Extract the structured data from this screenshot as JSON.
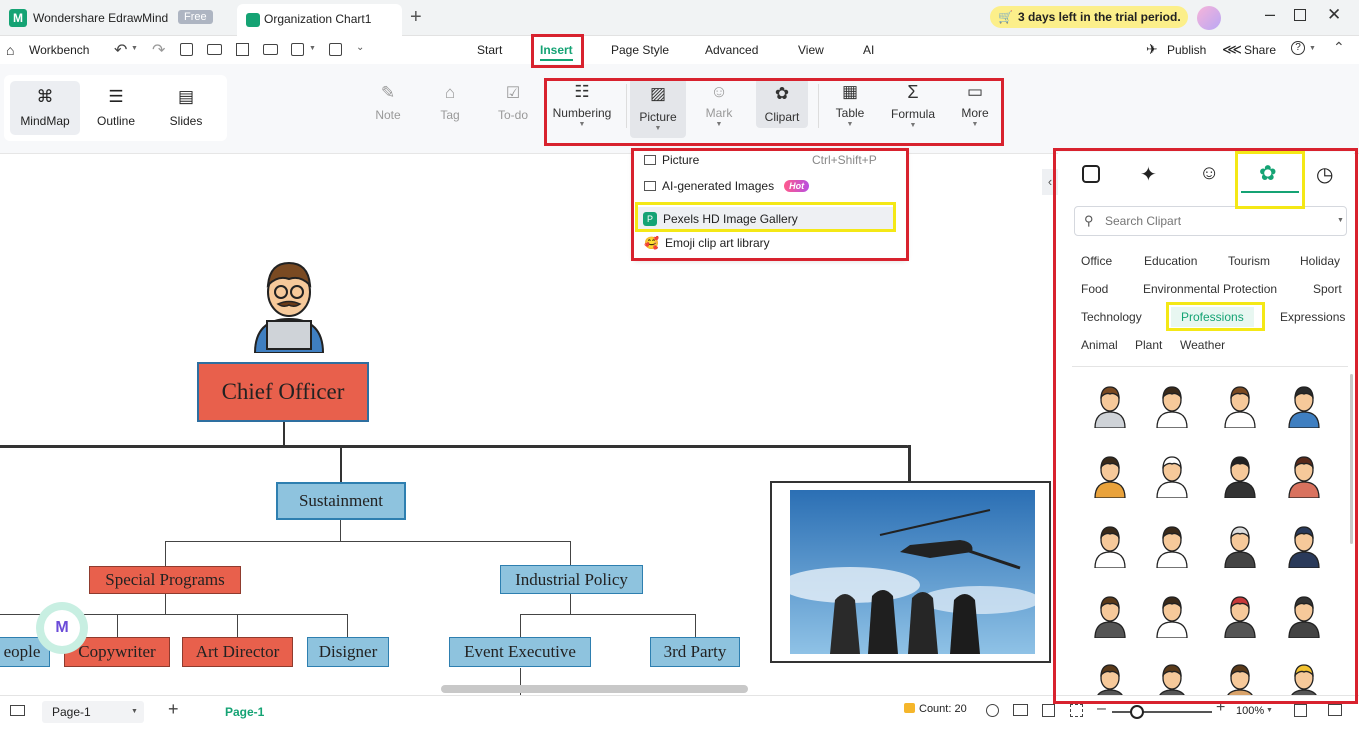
{
  "app": {
    "name": "Wondershare EdrawMind",
    "badge": "Free",
    "doc_tab": "Organization Chart1",
    "trial": "3 days left in the trial period."
  },
  "menu": {
    "workbench": "Workbench",
    "tabs": [
      "Start",
      "Insert",
      "Page Style",
      "Advanced",
      "View",
      "AI"
    ],
    "publish": "Publish",
    "share": "Share"
  },
  "ribbon": {
    "views": [
      "MindMap",
      "Outline",
      "Slides"
    ],
    "tools": [
      "Note",
      "Tag",
      "To-do",
      "Numbering",
      "Picture",
      "Mark",
      "Clipart",
      "Table",
      "Formula",
      "More"
    ]
  },
  "picture_menu": {
    "items": [
      {
        "label": "Picture",
        "shortcut": "Ctrl+Shift+P"
      },
      {
        "label": "AI-generated Images",
        "badge": "Hot"
      },
      {
        "label": "Pexels HD Image Gallery"
      },
      {
        "label": "Emoji clip art library"
      }
    ]
  },
  "clipart": {
    "search_placeholder": "Search Clipart",
    "categories": [
      "Office",
      "Education",
      "Tourism",
      "Holiday",
      "Food",
      "Environmental Protection",
      "Sport",
      "Technology",
      "Professions",
      "Expressions",
      "Animal",
      "Plant",
      "Weather"
    ]
  },
  "chart": {
    "nodes": [
      "Chief Officer",
      "Sustainment",
      "Special Programs",
      "Industrial Policy",
      "eople",
      "Copywriter",
      "Art Director",
      "Disigner",
      "Event Executive",
      "3rd Party"
    ]
  },
  "status": {
    "page_select": "Page-1",
    "page_tab": "Page-1",
    "count": "Count: 20",
    "zoom": "100%"
  },
  "colors": {
    "accent": "#1aa37a",
    "highlight_red": "#d8222e",
    "highlight_yellow": "#f4e816",
    "node_red": "#e8604c",
    "node_blue": "#8ec3de"
  }
}
